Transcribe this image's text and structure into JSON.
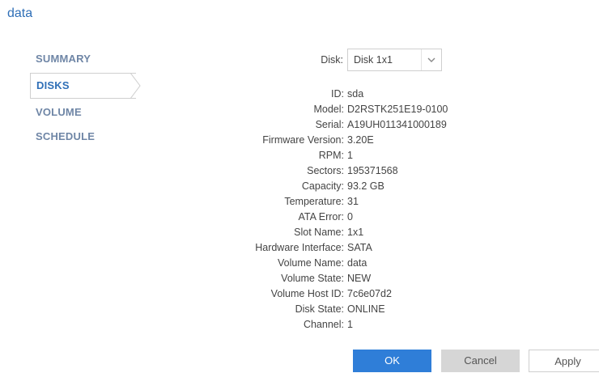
{
  "title": "data",
  "nav": {
    "items": [
      {
        "label": "SUMMARY",
        "active": false
      },
      {
        "label": "DISKS",
        "active": true
      },
      {
        "label": "VOLUME SCHEDULE",
        "active": false
      }
    ]
  },
  "disk_selector": {
    "label": "Disk:",
    "value": "Disk 1x1"
  },
  "details": [
    {
      "label": "ID:",
      "value": "sda"
    },
    {
      "label": "Model:",
      "value": "D2RSTK251E19-0100"
    },
    {
      "label": "Serial:",
      "value": "A19UH011341000189"
    },
    {
      "label": "Firmware Version:",
      "value": "3.20E"
    },
    {
      "label": "RPM:",
      "value": "1"
    },
    {
      "label": "Sectors:",
      "value": "195371568"
    },
    {
      "label": "Capacity:",
      "value": "93.2 GB"
    },
    {
      "label": "Temperature:",
      "value": "31"
    },
    {
      "label": "ATA Error:",
      "value": "0"
    },
    {
      "label": "Slot Name:",
      "value": "1x1"
    },
    {
      "label": "Hardware Interface:",
      "value": "SATA"
    },
    {
      "label": "Volume Name:",
      "value": "data"
    },
    {
      "label": "Volume State:",
      "value": "NEW"
    },
    {
      "label": "Volume Host ID:",
      "value": "7c6e07d2"
    },
    {
      "label": "Disk State:",
      "value": "ONLINE"
    },
    {
      "label": "Channel:",
      "value": "1"
    }
  ],
  "buttons": {
    "ok": "OK",
    "cancel": "Cancel",
    "apply": "Apply"
  },
  "colors": {
    "accent": "#2f7ed8",
    "title": "#2f6fb7",
    "nav_inactive": "#6f86a6"
  }
}
